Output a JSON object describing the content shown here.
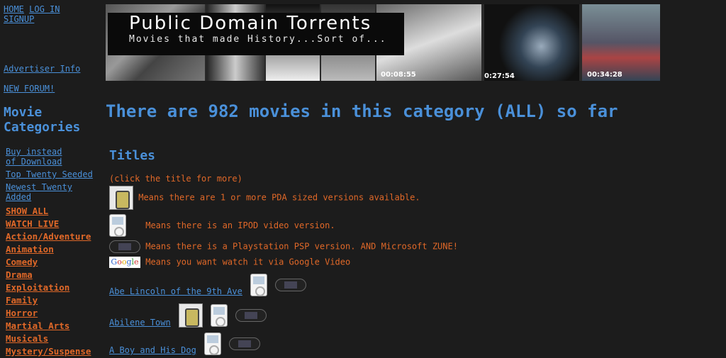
{
  "left": {
    "top_links": [
      "HOME",
      "LOG IN",
      "SIGNUP"
    ],
    "advertiser": "Advertiser Info",
    "forum": "NEW FORUM!",
    "movie_categories_title": "Movie Categories",
    "blue_links": [
      "Buy instead of Download",
      "Top Twenty Seeded",
      "Newest Twenty Added"
    ],
    "categories": [
      "SHOW ALL",
      "WATCH LIVE",
      "Action/Adventure",
      "Animation",
      "Comedy",
      "Drama",
      "Exploitation",
      "Family",
      "Horror",
      "Martial Arts",
      "Musicals",
      "Mystery/Suspense"
    ]
  },
  "banner": {
    "title": "Public Domain Torrents",
    "subtitle": "Movies that made History...Sort of...",
    "timestamps": [
      "00:08:55",
      "0:27:54",
      "00:34:28"
    ]
  },
  "main": {
    "headline": "There are 982 movies in this category (ALL) so far",
    "titles_heading": "Titles",
    "click_hint": "(click the title for more)",
    "legend": {
      "pda": "Means there are 1 or more PDA sized versions available.",
      "ipod": "Means there is an IPOD video version.",
      "psp": "Means there is a Playstation PSP version. AND Microsoft ZUNE!",
      "google": "Means you want watch it via Google Video",
      "google_logo": "Google"
    },
    "movies": [
      {
        "title": "Abe Lincoln of the 9th Ave",
        "icons": [
          "ipod",
          "psp"
        ]
      },
      {
        "title": "Abilene Town",
        "icons": [
          "pda",
          "ipod",
          "psp"
        ]
      },
      {
        "title": "A Boy and His Dog",
        "icons": [
          "ipod",
          "psp"
        ]
      }
    ]
  },
  "colors": {
    "background": "#1c1c1c",
    "link_blue": "#4a90d9",
    "accent_orange": "#e06828"
  }
}
